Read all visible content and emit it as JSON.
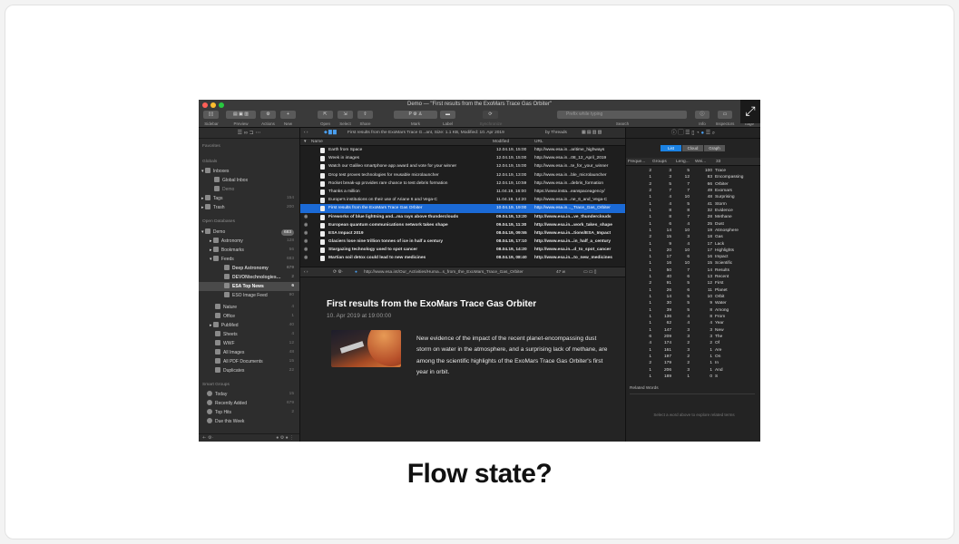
{
  "caption": "Flow state?",
  "window": {
    "title": "Demo — \"First results from the ExoMars Trace Gas Orbiter\"",
    "toolbar_labels": [
      "Sidebar",
      "Preview",
      "Actions",
      "New",
      "Open",
      "Select",
      "Share",
      "Mark",
      "Label",
      "Synchronize",
      "Search",
      "Info",
      "Inspectors",
      "nage"
    ],
    "search_placeholder": "Prefix while typing"
  },
  "sidebar": {
    "favorites": "Favorites",
    "globals": "Globals",
    "open_databases": "Open Databases",
    "smart_groups": "Smart Groups",
    "items": [
      {
        "label": "Inboxes",
        "count": ""
      },
      {
        "label": "Global Inbox",
        "count": ""
      },
      {
        "label": "Demo",
        "count": ""
      },
      {
        "label": "Tags",
        "count": "154"
      },
      {
        "label": "Trash",
        "count": "200"
      },
      {
        "label": "Demo",
        "count": "683"
      },
      {
        "label": "Astronomy",
        "count": "128"
      },
      {
        "label": "Bookmarks",
        "count": "56"
      },
      {
        "label": "Feeds",
        "count": "683"
      },
      {
        "label": "Deep Astronomy",
        "count": "679"
      },
      {
        "label": "DEVONtechnologies…",
        "count": "2"
      },
      {
        "label": "ESA Top News",
        "count": "6"
      },
      {
        "label": "ESO Image Feed",
        "count": "90"
      },
      {
        "label": "Nature",
        "count": "4"
      },
      {
        "label": "Office",
        "count": "1"
      },
      {
        "label": "PubMed",
        "count": "40"
      },
      {
        "label": "Sheets",
        "count": "4"
      },
      {
        "label": "WWF",
        "count": "12"
      },
      {
        "label": "All Images",
        "count": "48"
      },
      {
        "label": "All PDF Documents",
        "count": "15"
      },
      {
        "label": "Duplicates",
        "count": "22"
      },
      {
        "label": "Today",
        "count": "15"
      },
      {
        "label": "Recently Added",
        "count": "679"
      },
      {
        "label": "Top Hits",
        "count": "2"
      },
      {
        "label": "Due this Week",
        "count": ""
      }
    ]
  },
  "list": {
    "path_info": "First results from the ExoMars Trace G...ant, Size: 1.1 KB, Modified: 10. Apr 2019",
    "sort": "by Threads",
    "columns": {
      "name": "Name",
      "modified": "Modified",
      "url": "URL"
    },
    "rows": [
      {
        "name": "Earth from Space",
        "modified": "12.04.19, 15:00",
        "url": "http://www.esa.in...aritime_highways"
      },
      {
        "name": "Week in images",
        "modified": "12.04.19, 15:00",
        "url": "http://www.esa.in...08_12_April_2019"
      },
      {
        "name": "Watch our Galileo smartphone app award and vote for your winner",
        "modified": "12.04.19, 15:00",
        "url": "http://www.esa.in...te_for_your_winner"
      },
      {
        "name": "Drop test proves technologies for reusable microlauncher",
        "modified": "12.04.19, 13:00",
        "url": "http://www.esa.in...ble_microlauncher"
      },
      {
        "name": "Rocket break-up provides rare chance to test debris formation",
        "modified": "12.04.19, 10:59",
        "url": "http://www.esa.in...debris_formation"
      },
      {
        "name": "Thanks a million",
        "modified": "11.04.19, 16:00",
        "url": "https://www.insta...eanspaceagency/"
      },
      {
        "name": "Europe's institutions on their use of Ariane 6 and Vega-C",
        "modified": "11.04.19, 14:20",
        "url": "http://www.esa.in...ne_6_and_Vega-C"
      },
      {
        "name": "First results from the ExoMars Trace Gas Orbiter",
        "modified": "10.04.19, 19:00",
        "url": "http://www.esa.in..._Trace_Gas_Orbiter"
      },
      {
        "name": "Fireworks of blue lightning and...ma rays above thunderclouds",
        "modified": "09.04.19, 13:20",
        "url": "http://www.esa.in...ve_thunderclouds"
      },
      {
        "name": "European quantum communications network takes shape",
        "modified": "09.04.19, 11:30",
        "url": "http://www.esa.in...work_takes_shape"
      },
      {
        "name": "ESA Impact 2019",
        "modified": "08.04.19, 09:55",
        "url": "http://www.esa.in...tions/ESA_Impact"
      },
      {
        "name": "Glaciers lose nine trillion tonnes of ice in half a century",
        "modified": "08.04.19, 17:10",
        "url": "http://www.esa.in...in_half_a_century"
      },
      {
        "name": "Stargazing technology used to spot cancer",
        "modified": "08.04.19, 14:20",
        "url": "http://www.esa.in...d_to_spot_cancer"
      },
      {
        "name": "Martian soil detox could lead to new medicines",
        "modified": "08.04.19, 08:40",
        "url": "http://www.esa.in...to_new_medicines"
      }
    ]
  },
  "urlbar": {
    "url": "http://www.esa.int/Our_Activities/Huma...s_from_the_ExoMars_Trace_Gas_Orbiter",
    "words": "47 w"
  },
  "preview": {
    "title": "First results from the ExoMars Trace Gas Orbiter",
    "date": "10. Apr 2019 at 19:00:00",
    "body": "New evidence of the impact of the recent planet-encompassing dust storm on water in the atmosphere, and a surprising lack of methane, are among the scientific highlights of the ExoMars Trace Gas Orbiter's first year in orbit."
  },
  "inspector": {
    "tabs": [
      "List",
      "Cloud",
      "Graph"
    ],
    "columns": {
      "freq": "Freque...",
      "groups": "Groups",
      "length": "Leng...",
      "words": "Wei...",
      "count": "33"
    },
    "words": [
      [
        "2",
        "3",
        "5",
        "100",
        "Trace"
      ],
      [
        "1",
        "3",
        "12",
        "83",
        "Encompassing"
      ],
      [
        "2",
        "5",
        "7",
        "66",
        "Orbiter"
      ],
      [
        "2",
        "7",
        "7",
        "49",
        "Exomars"
      ],
      [
        "1",
        "4",
        "10",
        "48",
        "Surprising"
      ],
      [
        "1",
        "4",
        "5",
        "41",
        "Storm"
      ],
      [
        "1",
        "8",
        "8",
        "32",
        "Evidence"
      ],
      [
        "1",
        "8",
        "7",
        "28",
        "Methane"
      ],
      [
        "1",
        "6",
        "4",
        "25",
        "Dust"
      ],
      [
        "1",
        "14",
        "10",
        "19",
        "Atmosphere"
      ],
      [
        "2",
        "15",
        "3",
        "18",
        "Gas"
      ],
      [
        "1",
        "9",
        "4",
        "17",
        "Lack"
      ],
      [
        "1",
        "20",
        "10",
        "17",
        "Highlights"
      ],
      [
        "1",
        "17",
        "6",
        "16",
        "Impact"
      ],
      [
        "1",
        "16",
        "10",
        "15",
        "Scientific"
      ],
      [
        "1",
        "50",
        "7",
        "14",
        "Results"
      ],
      [
        "1",
        "40",
        "6",
        "13",
        "Recent"
      ],
      [
        "2",
        "91",
        "5",
        "12",
        "First"
      ],
      [
        "1",
        "26",
        "6",
        "11",
        "Planet"
      ],
      [
        "1",
        "14",
        "5",
        "10",
        "Orbit"
      ],
      [
        "1",
        "30",
        "5",
        "9",
        "Water"
      ],
      [
        "1",
        "39",
        "5",
        "8",
        "Among"
      ],
      [
        "1",
        "136",
        "4",
        "8",
        "From"
      ],
      [
        "1",
        "62",
        "4",
        "4",
        "Year"
      ],
      [
        "1",
        "147",
        "3",
        "3",
        "New"
      ],
      [
        "6",
        "209",
        "3",
        "3",
        "The"
      ],
      [
        "4",
        "174",
        "2",
        "2",
        "Of"
      ],
      [
        "1",
        "161",
        "3",
        "1",
        "Are"
      ],
      [
        "1",
        "197",
        "2",
        "1",
        "On"
      ],
      [
        "2",
        "179",
        "2",
        "1",
        "In"
      ],
      [
        "1",
        "206",
        "3",
        "1",
        "And"
      ],
      [
        "1",
        "189",
        "1",
        "0",
        "S"
      ]
    ],
    "related_title": "Related Words",
    "hint": "Select a word above to explore related terms"
  }
}
